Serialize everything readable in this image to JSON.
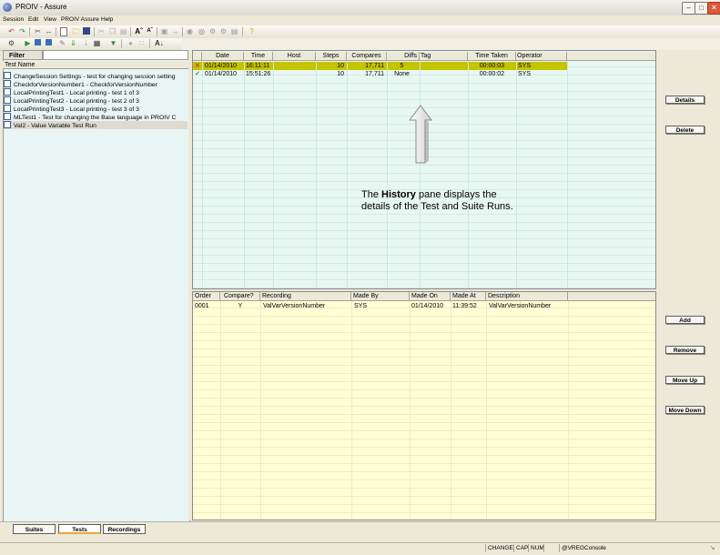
{
  "window": {
    "title": "PROIV - Assure"
  },
  "menu": {
    "items": [
      "Session",
      "Edit",
      "View",
      "PROIV Assure",
      "Help"
    ]
  },
  "filter": {
    "label": "Filter",
    "value": ""
  },
  "tests": {
    "header": "Test Name",
    "items": [
      "ChangeSession Settings - test for changing session setting",
      "CheckforVersionNumber1 - CheckforVersionNumber",
      "LocalPrintingTest1 - Local printing - test 1 of 3",
      "LocalPrintingTest2 - Local printing - test 2 of 3",
      "LocalPrintingTest3 - Local printing - test 3 of 3",
      "MLTest1 - Test for changing the Base language in PROIV C",
      "Val2 - Value Variable Test Run"
    ],
    "selected_index": 6
  },
  "history": {
    "columns": [
      "Date",
      "Time",
      "Host",
      "Steps",
      "Compares",
      "Diffs",
      "Tag",
      "Time Taken",
      "Operator"
    ],
    "rows": [
      {
        "status": "fail",
        "date": "01/14/2010",
        "time": "16:11:11",
        "host": "",
        "steps": "10",
        "compares": "17,711",
        "diffs": "5",
        "tag": "",
        "time_taken": "00:00:03",
        "operator": "SYS"
      },
      {
        "status": "pass",
        "date": "01/14/2010",
        "time": "15:51:26",
        "host": "",
        "steps": "10",
        "compares": "17,711",
        "diffs": "None",
        "tag": "",
        "time_taken": "00:00:02",
        "operator": "SYS"
      }
    ]
  },
  "annotation": {
    "before": "The ",
    "bold": "History",
    "after": " pane displays the details of the Test and Suite Runs."
  },
  "history_buttons": {
    "details": "Details",
    "delete": "Delete"
  },
  "recordings": {
    "columns": [
      "Order",
      "Compare?",
      "Recording",
      "Made By",
      "Made On",
      "Made At",
      "Description"
    ],
    "rows": [
      {
        "order": "0001",
        "compare": "Y",
        "recording": "ValVarVersionNumber",
        "made_by": "SYS",
        "made_on": "01/14/2010",
        "made_at": "11:39:52",
        "description": "ValVarVersionNumber"
      }
    ]
  },
  "recording_buttons": {
    "add": "Add",
    "remove": "Remove",
    "move_up": "Move Up",
    "move_down": "Move Down"
  },
  "tabs": [
    "Suites",
    "Tests",
    "Recordings"
  ],
  "active_tab": 1,
  "status": {
    "mode": "CHANGE",
    "caps": "CAP",
    "num": "NUM",
    "session": "@VREGConsole"
  },
  "colors": {
    "selected_row": "#c4c400",
    "history_bg": "#e9f7f3",
    "recording_bg": "#ffffd6",
    "tests_bg": "#e9f5f5"
  }
}
